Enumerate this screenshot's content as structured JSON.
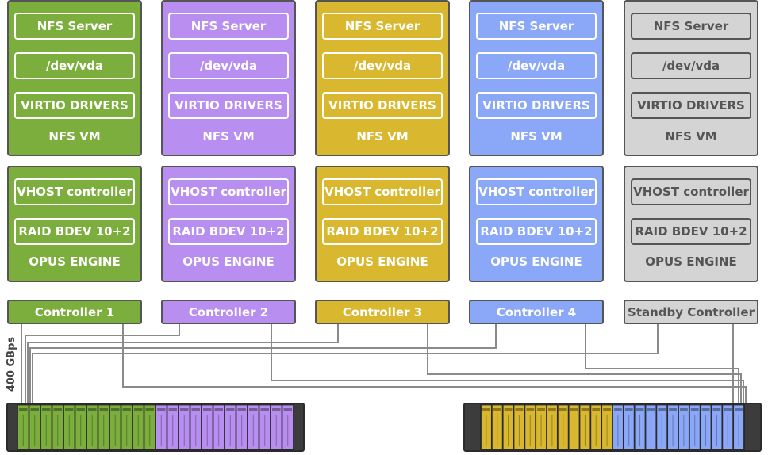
{
  "controllers": [
    {
      "vm_box_labels": [
        "NFS Server",
        "/dev/vda",
        "VIRTIO DRIVERS"
      ],
      "vm_label": "NFS VM",
      "engine_box_labels": [
        "VHOST controller",
        "RAID BDEV 10+2"
      ],
      "engine_label": "OPUS ENGINE",
      "controller_label": "Controller 1",
      "color": "#7cae3e",
      "text_color": "#ffffff"
    },
    {
      "vm_box_labels": [
        "NFS Server",
        "/dev/vda",
        "VIRTIO DRIVERS"
      ],
      "vm_label": "NFS VM",
      "engine_box_labels": [
        "VHOST controller",
        "RAID BDEV 10+2"
      ],
      "engine_label": "OPUS ENGINE",
      "controller_label": "Controller 2",
      "color": "#b88ff0",
      "text_color": "#ffffff"
    },
    {
      "vm_box_labels": [
        "NFS Server",
        "/dev/vda",
        "VIRTIO DRIVERS"
      ],
      "vm_label": "NFS VM",
      "engine_box_labels": [
        "VHOST controller",
        "RAID BDEV 10+2"
      ],
      "engine_label": "OPUS ENGINE",
      "controller_label": "Controller 3",
      "color": "#d9b830",
      "text_color": "#ffffff"
    },
    {
      "vm_box_labels": [
        "NFS Server",
        "/dev/vda",
        "VIRTIO DRIVERS"
      ],
      "vm_label": "NFS VM",
      "engine_box_labels": [
        "VHOST controller",
        "RAID BDEV 10+2"
      ],
      "engine_label": "OPUS ENGINE",
      "controller_label": "Controller 4",
      "color": "#8ba8f8",
      "text_color": "#ffffff"
    },
    {
      "vm_box_labels": [
        "NFS Server",
        "/dev/vda",
        "VIRTIO DRIVERS"
      ],
      "vm_label": "NFS VM",
      "engine_box_labels": [
        "VHOST controller",
        "RAID BDEV 10+2"
      ],
      "engine_label": "OPUS ENGINE",
      "controller_label": "Standby Controller",
      "color": "#d4d4d4",
      "text_color": "#555555"
    }
  ],
  "bandwidth_label": "400 GBps",
  "enclosures": [
    {
      "name": "left-enclosure",
      "colors": [
        "#7cae3e",
        "#b88ff0"
      ],
      "icon": "drive-enclosure-icon"
    },
    {
      "name": "right-enclosure",
      "colors": [
        "#d9b830",
        "#8ba8f8"
      ],
      "icon": "drive-enclosure-icon"
    }
  ],
  "colors": {
    "border": "#555555",
    "wire": "#8a8a8a",
    "chassis": "#2b2b2b"
  }
}
